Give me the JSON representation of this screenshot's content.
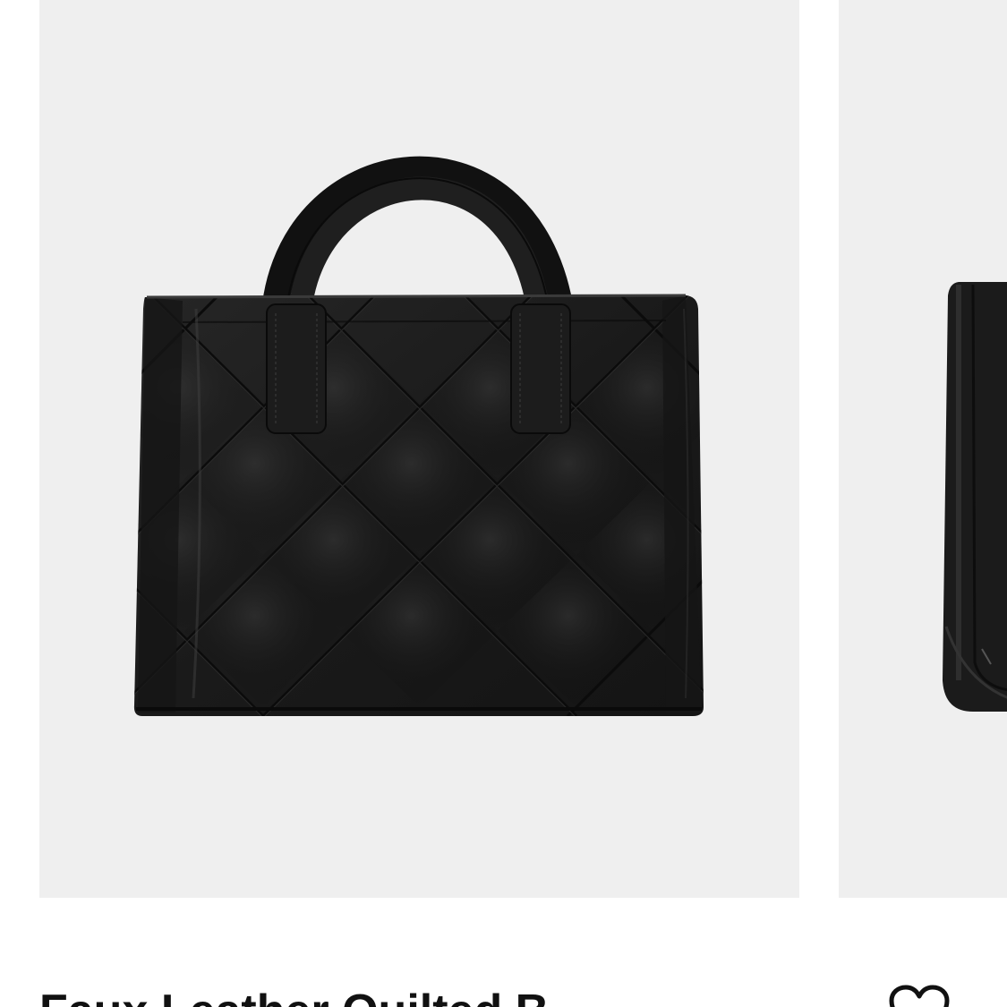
{
  "product": {
    "title": "Faux Leather Quilted B",
    "image_alt": "Black faux leather quilted tote bag",
    "image_background": "#efefef",
    "bag_color": "#1b1b1b"
  },
  "actions": {
    "wishlist_icon": "heart-outline-icon"
  }
}
